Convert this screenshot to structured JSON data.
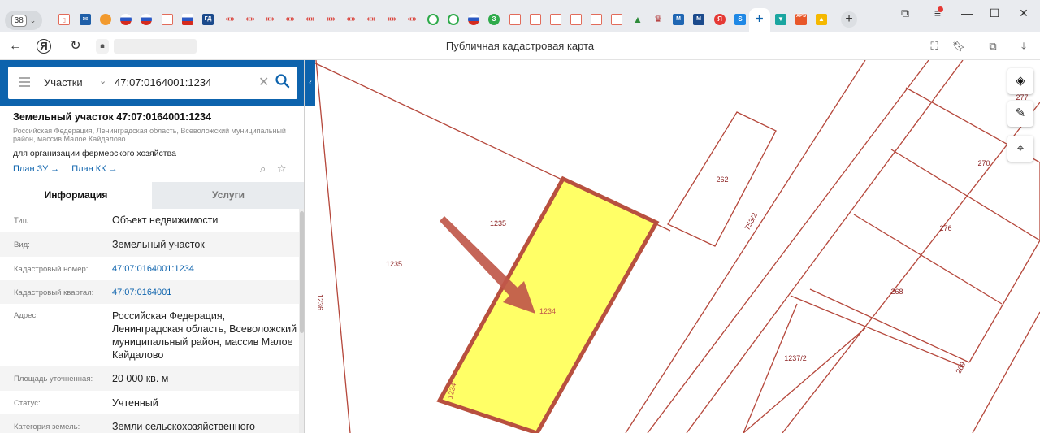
{
  "browser": {
    "tab_count": "38",
    "page_title": "Публичная кадастровая карта"
  },
  "search": {
    "type_label": "Участки",
    "query": "47:07:0164001:1234"
  },
  "object": {
    "title": "Земельный участок 47:07:0164001:1234",
    "address_short": "Российская Федерация, Ленинградская область, Всеволожский муниципальный район, массив Малое Кайдалово",
    "purpose": "для организации фермерского хозяйства",
    "plan_zu": "План ЗУ →",
    "plan_kk": "План КК →"
  },
  "tabs": {
    "info": "Информация",
    "services": "Услуги"
  },
  "info_rows": [
    {
      "label": "Тип:",
      "value": "Объект недвижимости"
    },
    {
      "label": "Вид:",
      "value": "Земельный участок"
    },
    {
      "label": "Кадастровый номер:",
      "value": "47:07:0164001:1234"
    },
    {
      "label": "Кадастровый квартал:",
      "value": "47:07:0164001"
    },
    {
      "label": "Адрес:",
      "value": "Российская Федерация, Ленинградская область, Всеволожский муниципальный район, массив Малое Кайдалово"
    },
    {
      "label": "Площадь уточненная:",
      "value": "20 000 кв. м"
    },
    {
      "label": "Статус:",
      "value": "Учтенный"
    },
    {
      "label": "Категория земель:",
      "value": "Земли сельскохозяйственного"
    }
  ],
  "map_labels": {
    "p1234": "1234",
    "p1234_side": "1234",
    "p1235a": "1235",
    "p1235b": "1235",
    "p1236": "1236",
    "p262": "262",
    "p753": "753/2",
    "p277": "277",
    "p270": "270",
    "p276": "276",
    "p268": "268",
    "p1237": "1237/2",
    "p269": "269"
  },
  "colors": {
    "brand_blue": "#0d63ad",
    "parcel_line": "#b5473b",
    "selected_fill": "#ffff66",
    "selected_border": "#b8503f"
  }
}
